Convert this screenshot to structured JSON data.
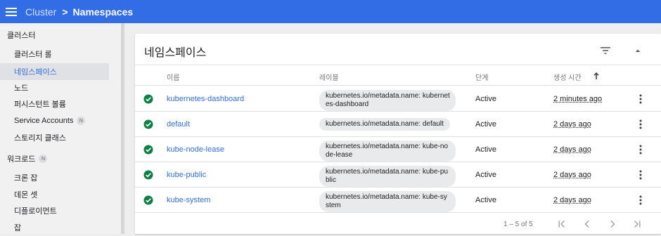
{
  "header": {
    "breadcrumb_parent": "Cluster",
    "breadcrumb_current": "Namespaces",
    "menu_icon": "hamburger-menu-icon",
    "bar_color": "#326de6"
  },
  "sidebar": {
    "cluster_section": "클러스터",
    "cluster_items": [
      {
        "label": "클러스터 롤",
        "active": false
      },
      {
        "label": "네임스페이스",
        "active": true
      },
      {
        "label": "노드",
        "active": false
      },
      {
        "label": "퍼시스턴트 볼륨",
        "active": false
      },
      {
        "label": "Service Accounts",
        "badge": "N",
        "active": false
      },
      {
        "label": "스토리지 클래스",
        "active": false
      }
    ],
    "workload_section": "워크로드",
    "workload_badge": "N",
    "workload_items": [
      {
        "label": "크론 잡"
      },
      {
        "label": "데몬 셋"
      },
      {
        "label": "디플로이먼트"
      },
      {
        "label": "잡"
      }
    ]
  },
  "card": {
    "title": "네임스페이스",
    "filter_icon": "filter-list-icon",
    "collapse_icon": "expand-less-icon"
  },
  "table": {
    "columns": {
      "name": "이름",
      "labels": "레이블",
      "phase": "단계",
      "created": "생성 시간"
    },
    "sort_icon": "arrow-upward-icon",
    "status_color": "#0b8043",
    "rows": [
      {
        "name": "kubernetes-dashboard",
        "label": "kubernetes.io/metadata.name: kubernetes-dashboard",
        "phase": "Active",
        "age": "2 minutes ago"
      },
      {
        "name": "default",
        "label": "kubernetes.io/metadata.name: default",
        "phase": "Active",
        "age": "2 days ago"
      },
      {
        "name": "kube-node-lease",
        "label": "kubernetes.io/metadata.name: kube-node-lease",
        "phase": "Active",
        "age": "2 days ago"
      },
      {
        "name": "kube-public",
        "label": "kubernetes.io/metadata.name: kube-public",
        "phase": "Active",
        "age": "2 days ago"
      },
      {
        "name": "kube-system",
        "label": "kubernetes.io/metadata.name: kube-system",
        "phase": "Active",
        "age": "2 days ago"
      }
    ]
  },
  "pagination": {
    "range": "1 – 5 of 5",
    "icons": [
      "first-page-icon",
      "chevron-left-icon",
      "chevron-right-icon",
      "last-page-icon"
    ]
  }
}
